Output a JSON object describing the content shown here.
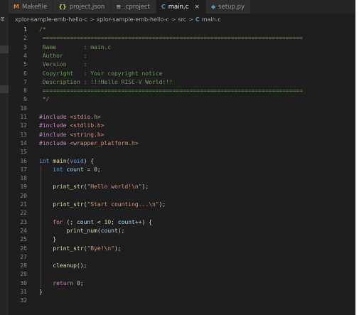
{
  "tabs": [
    {
      "icon": "M",
      "icon_name": "makefile-icon",
      "icon_color": "#e37933",
      "label": "Makefile",
      "active": false
    },
    {
      "icon": "{}",
      "icon_name": "json-icon",
      "icon_color": "#cbcb41",
      "label": "project.json",
      "active": false
    },
    {
      "icon": "≡",
      "icon_name": "file-lines-icon",
      "icon_color": "#a9a9a9",
      "label": ".cproject",
      "active": false
    },
    {
      "icon": "C",
      "icon_name": "c-file-icon",
      "icon_color": "#519aba",
      "label": "main.c",
      "active": true,
      "close": "×"
    },
    {
      "icon": "◆",
      "icon_name": "python-icon",
      "icon_color": "#519aba",
      "label": "setup.py",
      "active": false
    }
  ],
  "breadcrumb": {
    "items": [
      "xplor-sample-emb-hello-c",
      "xplor-sample-emb-hello-c",
      "src"
    ],
    "separator": ">",
    "file_icon": "C",
    "file": "main.c"
  },
  "editor": {
    "current_line": 1,
    "lines": [
      [
        [
          "cmt",
          "/*"
        ]
      ],
      [
        [
          "cmt",
          " ============================================================================"
        ]
      ],
      [
        [
          "cmt",
          " Name        : main.c"
        ]
      ],
      [
        [
          "cmt",
          " Author      :"
        ]
      ],
      [
        [
          "cmt",
          " Version     :"
        ]
      ],
      [
        [
          "cmt",
          " Copyright   : Your copyright notice"
        ]
      ],
      [
        [
          "cmt",
          " Description : !!!Hello RISC-V World!!!"
        ]
      ],
      [
        [
          "cmt",
          " ============================================================================"
        ]
      ],
      [
        [
          "cmt",
          " */"
        ]
      ],
      [],
      [
        [
          "ctl",
          "#include"
        ],
        [
          "pln",
          " "
        ],
        [
          "str",
          "<stdio.h>"
        ]
      ],
      [
        [
          "ctl",
          "#include"
        ],
        [
          "pln",
          " "
        ],
        [
          "str",
          "<stdlib.h>"
        ]
      ],
      [
        [
          "ctl",
          "#include"
        ],
        [
          "pln",
          " "
        ],
        [
          "str",
          "<string.h>"
        ]
      ],
      [
        [
          "ctl",
          "#include"
        ],
        [
          "pln",
          " "
        ],
        [
          "str",
          "<wrapper_platform.h>"
        ]
      ],
      [],
      [
        [
          "kw",
          "int"
        ],
        [
          "pln",
          " "
        ],
        [
          "fn",
          "main"
        ],
        [
          "pln",
          "("
        ],
        [
          "kw",
          "void"
        ],
        [
          "pln",
          ") {"
        ]
      ],
      [
        [
          "pln",
          "    "
        ],
        [
          "kw",
          "int"
        ],
        [
          "pln",
          " "
        ],
        [
          "var",
          "count"
        ],
        [
          "pln",
          " = "
        ],
        [
          "num",
          "0"
        ],
        [
          "pln",
          ";"
        ]
      ],
      [],
      [
        [
          "pln",
          "    "
        ],
        [
          "fn",
          "print_str"
        ],
        [
          "pln",
          "("
        ],
        [
          "str",
          "\"Hello world!\\n\""
        ],
        [
          "pln",
          ");"
        ]
      ],
      [],
      [
        [
          "pln",
          "    "
        ],
        [
          "fn",
          "print_str"
        ],
        [
          "pln",
          "("
        ],
        [
          "str",
          "\"Start counting...\\n\""
        ],
        [
          "pln",
          ");"
        ]
      ],
      [],
      [
        [
          "pln",
          "    "
        ],
        [
          "ctl",
          "for"
        ],
        [
          "pln",
          " (; "
        ],
        [
          "var",
          "count"
        ],
        [
          "pln",
          " < "
        ],
        [
          "num",
          "10"
        ],
        [
          "pln",
          "; "
        ],
        [
          "var",
          "count"
        ],
        [
          "pln",
          "++) {"
        ]
      ],
      [
        [
          "pln",
          "        "
        ],
        [
          "fn",
          "print_num"
        ],
        [
          "pln",
          "("
        ],
        [
          "var",
          "count"
        ],
        [
          "pln",
          ");"
        ]
      ],
      [
        [
          "pln",
          "    }"
        ]
      ],
      [
        [
          "pln",
          "    "
        ],
        [
          "fn",
          "print_str"
        ],
        [
          "pln",
          "("
        ],
        [
          "str",
          "\"Bye!\\n\""
        ],
        [
          "pln",
          ");"
        ]
      ],
      [],
      [
        [
          "pln",
          "    "
        ],
        [
          "fn",
          "cleanup"
        ],
        [
          "pln",
          "();"
        ]
      ],
      [],
      [
        [
          "pln",
          "    "
        ],
        [
          "ctl",
          "return"
        ],
        [
          "pln",
          " "
        ],
        [
          "num",
          "0"
        ],
        [
          "pln",
          ";"
        ]
      ],
      [
        [
          "pln",
          "}"
        ]
      ],
      []
    ]
  }
}
